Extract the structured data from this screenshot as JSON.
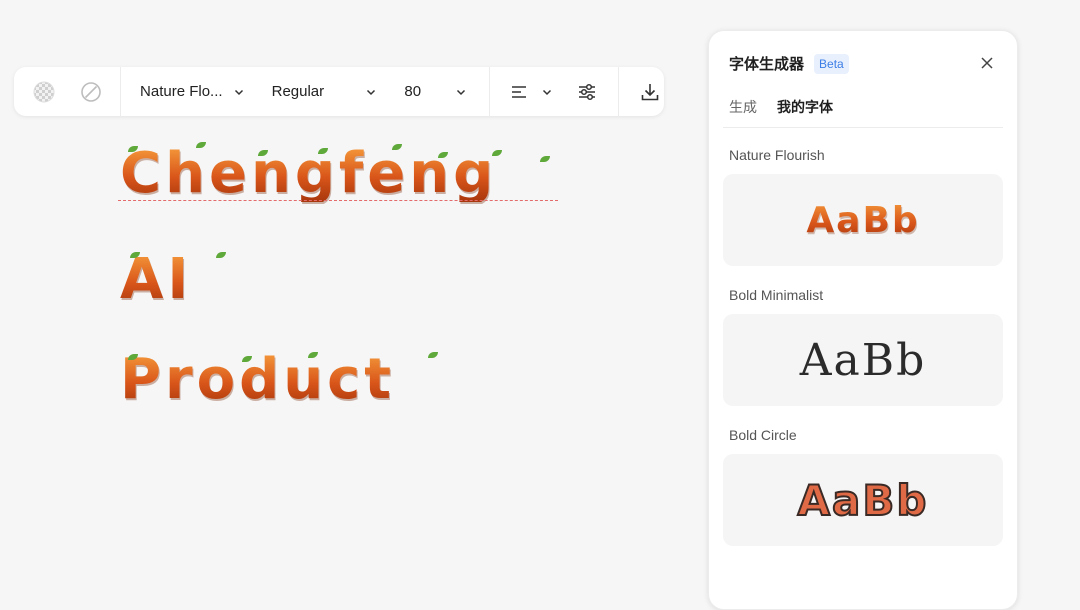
{
  "toolbar": {
    "font_name": "Nature Flo...",
    "font_weight": "Regular",
    "font_size": "80",
    "icons": [
      "transparency-icon",
      "no-fill-icon",
      "align-left-icon",
      "sliders-icon",
      "download-icon"
    ]
  },
  "canvas": {
    "lines": [
      "Chengfeng",
      "AI",
      "Product"
    ],
    "text_color": "#d9561a",
    "leaf_color": "#5fa83a"
  },
  "panel": {
    "title": "字体生成器",
    "badge": "Beta",
    "tabs": [
      {
        "label": "生成",
        "active": false
      },
      {
        "label": "我的字体",
        "active": true
      }
    ],
    "fonts": [
      {
        "name": "Nature Flourish",
        "sample": "AaBb"
      },
      {
        "name": "Bold Minimalist",
        "sample": "AaBb"
      },
      {
        "name": "Bold Circle",
        "sample": "AaBb"
      }
    ]
  }
}
